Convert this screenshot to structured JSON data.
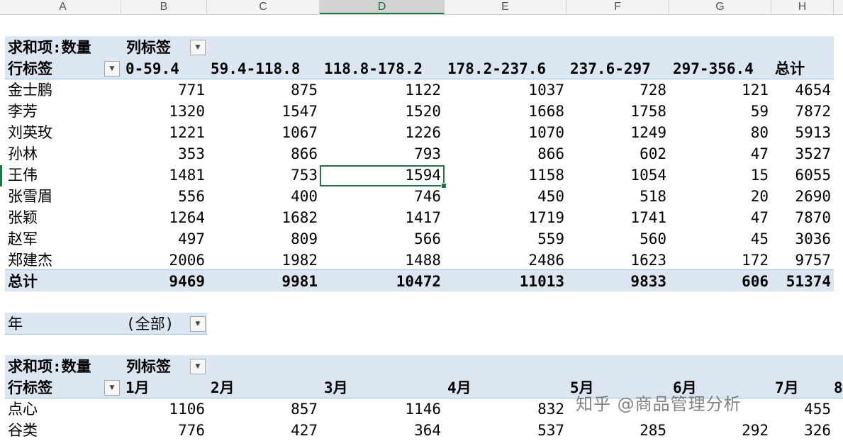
{
  "columns": [
    "A",
    "B",
    "C",
    "D",
    "E",
    "F",
    "G",
    "H"
  ],
  "pivot1": {
    "value_label": "求和项:数量",
    "col_label": "列标签",
    "row_label": "行标签",
    "col_headers": [
      "0-59.4",
      "59.4-118.8",
      "118.8-178.2",
      "178.2-237.6",
      "237.6-297",
      "297-356.4",
      "总计"
    ],
    "rows": [
      {
        "name": "金士鹏",
        "values": [
          "771",
          "875",
          "1122",
          "1037",
          "728",
          "121",
          "4654"
        ]
      },
      {
        "name": "李芳",
        "values": [
          "1320",
          "1547",
          "1520",
          "1668",
          "1758",
          "59",
          "7872"
        ]
      },
      {
        "name": "刘英玫",
        "values": [
          "1221",
          "1067",
          "1226",
          "1070",
          "1249",
          "80",
          "5913"
        ]
      },
      {
        "name": "孙林",
        "values": [
          "353",
          "866",
          "793",
          "866",
          "602",
          "47",
          "3527"
        ]
      },
      {
        "name": "王伟",
        "values": [
          "1481",
          "753",
          "1594",
          "1158",
          "1054",
          "15",
          "6055"
        ]
      },
      {
        "name": "张雪眉",
        "values": [
          "556",
          "400",
          "746",
          "450",
          "518",
          "20",
          "2690"
        ]
      },
      {
        "name": "张颖",
        "values": [
          "1264",
          "1682",
          "1417",
          "1719",
          "1741",
          "47",
          "7870"
        ]
      },
      {
        "name": "赵军",
        "values": [
          "497",
          "809",
          "566",
          "559",
          "560",
          "45",
          "3036"
        ]
      },
      {
        "name": "郑建杰",
        "values": [
          "2006",
          "1982",
          "1488",
          "2486",
          "1623",
          "172",
          "9757"
        ]
      }
    ],
    "total": {
      "name": "总计",
      "values": [
        "9469",
        "9981",
        "10472",
        "11013",
        "9833",
        "606",
        "51374"
      ]
    }
  },
  "filter": {
    "label": "年",
    "value": "(全部)"
  },
  "pivot2": {
    "value_label": "求和项:数量",
    "col_label": "列标签",
    "row_label": "行标签",
    "col_headers": [
      "1月",
      "2月",
      "3月",
      "4月",
      "5月",
      "6月",
      "7月",
      "8"
    ],
    "rows": [
      {
        "name": "点心",
        "values": [
          "1106",
          "857",
          "1146",
          "832",
          "",
          "",
          "455"
        ]
      },
      {
        "name": "谷类",
        "values": [
          "776",
          "427",
          "364",
          "537",
          "285",
          "292",
          "326"
        ]
      }
    ]
  },
  "watermark": "知乎 @商品管理分析",
  "icons": {
    "dropdown": "dropdown-arrow-icon"
  },
  "colors": {
    "band": "#dce6f1",
    "accent": "#217346"
  }
}
